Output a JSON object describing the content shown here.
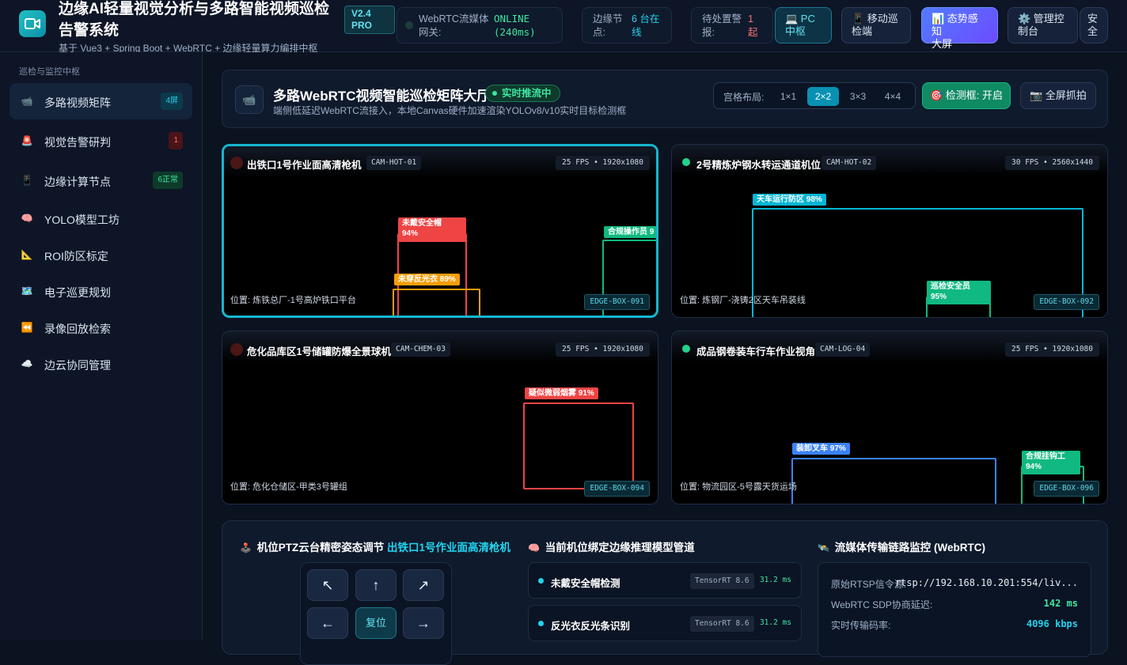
{
  "header": {
    "title": "边缘AI轻量视觉分析与多路智能视频巡检告警系统",
    "subtitle": "基于 Vue3 + Spring Boot + WebRTC + 边缘轻量算力编排中枢",
    "version_line1": "V2.4",
    "version_line2": "PRO",
    "stats": [
      {
        "label_line1": "WebRTC流媒体",
        "label_line2": "网关:",
        "value_line1": "ONLINE",
        "value_line2": "(240ms)",
        "color": "#3ee6a0"
      },
      {
        "label_line1": "边缘节",
        "label_line2": "点:",
        "value_line1": "6 台在",
        "value_line2": "线",
        "color": "#22d3ee"
      },
      {
        "label_line1": "待处置警",
        "label_line2": "报:",
        "value_line1": "1",
        "value_line2": "起",
        "color": "#f87171"
      }
    ],
    "buttons": [
      {
        "label_line1": "💻 PC",
        "label_line2": "中枢"
      },
      {
        "label_line1": "📱 移动巡",
        "label_line2": "检端"
      },
      {
        "label_line1": "📊 态势感知",
        "label_line2": "大屏"
      },
      {
        "label_line1": "⚙️ 管理控",
        "label_line2": "制台"
      },
      {
        "label_line1": "安",
        "label_line2": "全"
      }
    ]
  },
  "sidebar": {
    "section_title": "巡检与监控中枢",
    "items": [
      {
        "icon": "📹",
        "label": "多路视频矩阵",
        "badge": "4屏"
      },
      {
        "icon": "🚨",
        "label": "视觉告警研判",
        "badge": "1"
      },
      {
        "icon": "📱",
        "label": "边缘计算节点",
        "badge": "6正常"
      },
      {
        "icon": "🧠",
        "label": "YOLO模型工坊",
        "badge": ""
      },
      {
        "icon": "📐",
        "label": "ROI防区标定",
        "badge": ""
      },
      {
        "icon": "🗺️",
        "label": "电子巡更规划",
        "badge": ""
      },
      {
        "icon": "⏪",
        "label": "录像回放检索",
        "badge": ""
      },
      {
        "icon": "☁️",
        "label": "边云协同管理",
        "badge": ""
      }
    ]
  },
  "matrix": {
    "icon": "📹",
    "title": "多路WebRTC视频智能巡检矩阵大厅",
    "live_badge": "实时推流中",
    "description": "端侧低延迟WebRTC流接入，本地Canvas硬件加速渲染YOLOv8/v10实时目标检测框",
    "grid_label": "宫格布局:",
    "grid_options": [
      "1×1",
      "2×2",
      "3×3",
      "4×4"
    ],
    "grid_selected": "2×2",
    "detect_button": "🎯 检测框: 开启",
    "capture_button": "📷 全屏抓拍"
  },
  "cameras": [
    {
      "name": "出铁口1号作业面高清枪机",
      "id": "CAM-HOT-01",
      "fps": "25 FPS • 1920x1080",
      "location": "位置: 炼铁总厂-1号高炉铁口平台",
      "edge": "EDGE-BOX-091",
      "status": "alarm",
      "detections": [
        {
          "label_line1": "未戴安全帽",
          "label_line2": "94%",
          "color": "#ef4444"
        },
        {
          "label_line1": "未穿反光衣 89%",
          "label_line2": "",
          "color": "#f59e0b"
        },
        {
          "label_line1": "合规操作员 9",
          "label_line2": "",
          "color": "#10b981"
        }
      ]
    },
    {
      "name": "2号精炼炉钢水转运通道机位",
      "id": "CAM-HOT-02",
      "fps": "30 FPS • 2560x1440",
      "location": "位置: 炼钢厂-浇铸2区天车吊装线",
      "edge": "EDGE-BOX-092",
      "status": "ok",
      "detections": [
        {
          "label_line1": "天车运行防区 98%",
          "label_line2": "",
          "color": "#06b6d4"
        },
        {
          "label_line1": "巡检安全员",
          "label_line2": "95%",
          "color": "#10b981"
        }
      ]
    },
    {
      "name": "危化品库区1号储罐防爆全景球机",
      "id": "CAM-CHEM-03",
      "fps": "25 FPS • 1920x1080",
      "location": "位置: 危化仓储区-甲类3号罐组",
      "edge": "EDGE-BOX-094",
      "status": "alarm",
      "detections": [
        {
          "label_line1": "疑似微弱烟雾 91%",
          "label_line2": "",
          "color": "#ef4444"
        }
      ]
    },
    {
      "name": "成品钢卷装车行车作业视角",
      "id": "CAM-LOG-04",
      "fps": "25 FPS • 1920x1080",
      "location": "位置: 物流园区-5号露天货运场",
      "edge": "EDGE-BOX-096",
      "status": "ok",
      "detections": [
        {
          "label_line1": "装卸叉车 97%",
          "label_line2": "",
          "color": "#3b82f6"
        },
        {
          "label_line1": "合规挂钩工",
          "label_line2": "94%",
          "color": "#10b981"
        }
      ]
    }
  ],
  "ptz": {
    "icon": "🕹️",
    "title": "机位PTZ云台精密姿态调节",
    "target": "出铁口1号作业面高清枪机",
    "buttons": {
      "up_left": "↖",
      "up": "↑",
      "up_right": "↗",
      "left": "←",
      "reset": "复位",
      "right": "→"
    }
  },
  "models": {
    "icon": "🧠",
    "title": "当前机位绑定边缘推理模型管道",
    "rows": [
      {
        "name": "未戴安全帽检测",
        "engine": "TensorRT 8.6",
        "latency": "31.2 ms"
      },
      {
        "name": "反光衣反光条识别",
        "engine": "TensorRT 8.6",
        "latency": "31.2 ms"
      }
    ]
  },
  "link": {
    "icon": "🛰️",
    "title": "流媒体传输链路监控 (WebRTC)",
    "rows": [
      {
        "label": "原始RTSP信令源:",
        "value": "rtsp://192.168.10.201:554/liv...",
        "color": "#e6eef8"
      },
      {
        "label": "WebRTC SDP协商延迟:",
        "value": "142 ms",
        "color": "#3ee6a0"
      },
      {
        "label": "实时传输码率:",
        "value": "4096 kbps",
        "color": "#22d3ee"
      }
    ]
  }
}
